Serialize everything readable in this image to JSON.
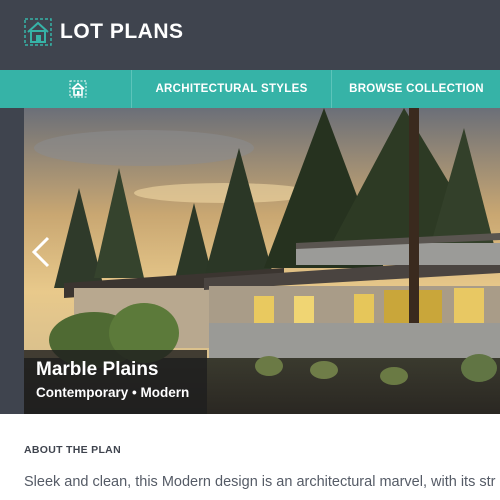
{
  "header": {
    "logo_text": "LOT PLANS",
    "logo_icon": "house-blueprint-icon"
  },
  "nav": {
    "home_icon": "house-icon",
    "items": [
      {
        "label": "ARCHITECTURAL STYLES"
      },
      {
        "label": "BROWSE COLLECTION"
      }
    ]
  },
  "hero": {
    "title": "Marble Plains",
    "subtitle": "Contemporary • Modern",
    "prev_icon": "chevron-left-icon"
  },
  "about": {
    "heading": "ABOUT THE PLAN",
    "description": "Sleek and clean, this Modern design is an architectural marvel, with its str"
  },
  "colors": {
    "header_bg": "#3f444e",
    "nav_bg": "#36b3a7",
    "text_dark": "#3f444e"
  }
}
